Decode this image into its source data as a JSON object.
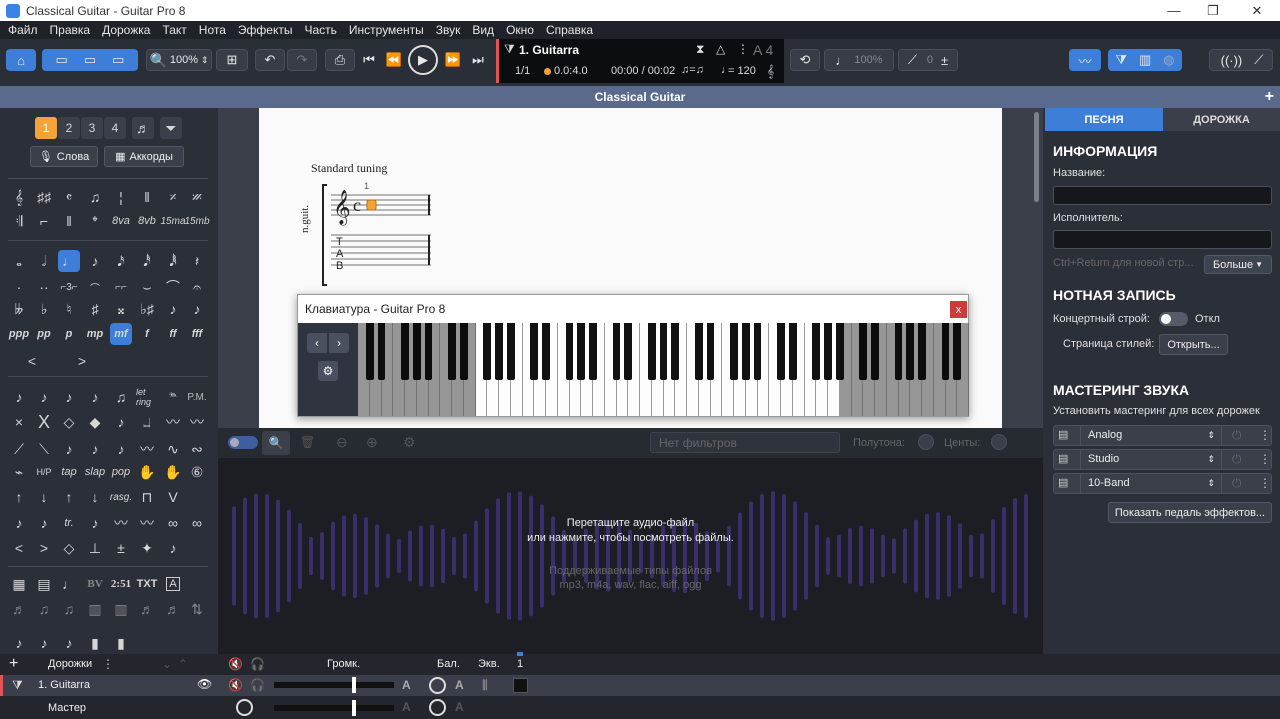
{
  "window": {
    "title": "Classical Guitar - Guitar Pro 8"
  },
  "menu": [
    "Файл",
    "Правка",
    "Дорожка",
    "Такт",
    "Нота",
    "Эффекты",
    "Часть",
    "Инструменты",
    "Звук",
    "Вид",
    "Окно",
    "Справка"
  ],
  "toolbar": {
    "zoom": "100%",
    "track_name": "1. Guitarra",
    "bar_pos": "1/1",
    "beat_pos": "0.0:4.0",
    "time": "00:00 / 00:02",
    "tempo": "= 120",
    "key_note": "A 4",
    "speed": "100%",
    "count_in": "0"
  },
  "doc_title": "Classical Guitar",
  "left_palette": {
    "voices": [
      "1",
      "2",
      "3",
      "4"
    ],
    "lyrics_btn": "Слова",
    "chords_btn": "Аккорды",
    "dynamics": [
      "ppp",
      "pp",
      "p",
      "mp",
      "mf",
      "f",
      "ff",
      "fff"
    ],
    "text_tools": [
      "BV",
      "2:51",
      "TXT",
      "A"
    ]
  },
  "score": {
    "tuning": "Standard tuning",
    "instrument_abbr": "n.guit.",
    "bar_number": "1",
    "tab_letters": [
      "T",
      "A",
      "B"
    ]
  },
  "keyboard": {
    "title": "Клавиатура - Guitar Pro 8",
    "close": "x"
  },
  "audio_toolbar": {
    "filter": "Нет фильтров",
    "semitones": "Полутона:",
    "cents": "Центы:"
  },
  "audio_drop": {
    "line1": "Перетащите аудио-файл",
    "line2": "или нажмите, чтобы посмотреть файлы.",
    "types_title": "Поддерживаемые типы файлов",
    "types": "mp3, m4a, wav, flac, aiff, ogg"
  },
  "right_panel": {
    "tabs": [
      "ПЕСНЯ",
      "ДОРОЖКА"
    ],
    "info_header": "ИНФОРМАЦИЯ",
    "name_label": "Название:",
    "name_value": "",
    "artist_label": "Исполнитель:",
    "artist_value": "",
    "newline_hint": "Ctrl+Return для новой стр...",
    "more_btn": "Больше",
    "notation_header": "НОТНАЯ ЗАПИСЬ",
    "concert_label": "Концертный строй:",
    "concert_state": "Откл",
    "stylesheet_label": "Страница стилей:",
    "open_btn": "Открыть...",
    "mastering_header": "МАСТЕРИНГ ЗВУКА",
    "mastering_all": "Установить  мастеринг для всех дорожек",
    "mastering_items": [
      "Analog",
      "Studio",
      "10-Band"
    ],
    "pedals_btn": "Показать педаль эффектов..."
  },
  "tracks": {
    "header": "Дорожки",
    "vol": "Громк.",
    "bal": "Бал.",
    "eq": "Экв.",
    "bar": "1",
    "rows": [
      {
        "name": "1. Guitarra"
      },
      {
        "name": "Мастер"
      }
    ]
  },
  "colors": {
    "accent": "#3d7ed8",
    "orange": "#f2a33a",
    "red": "#e05555",
    "wave": "#3a2f6b"
  }
}
